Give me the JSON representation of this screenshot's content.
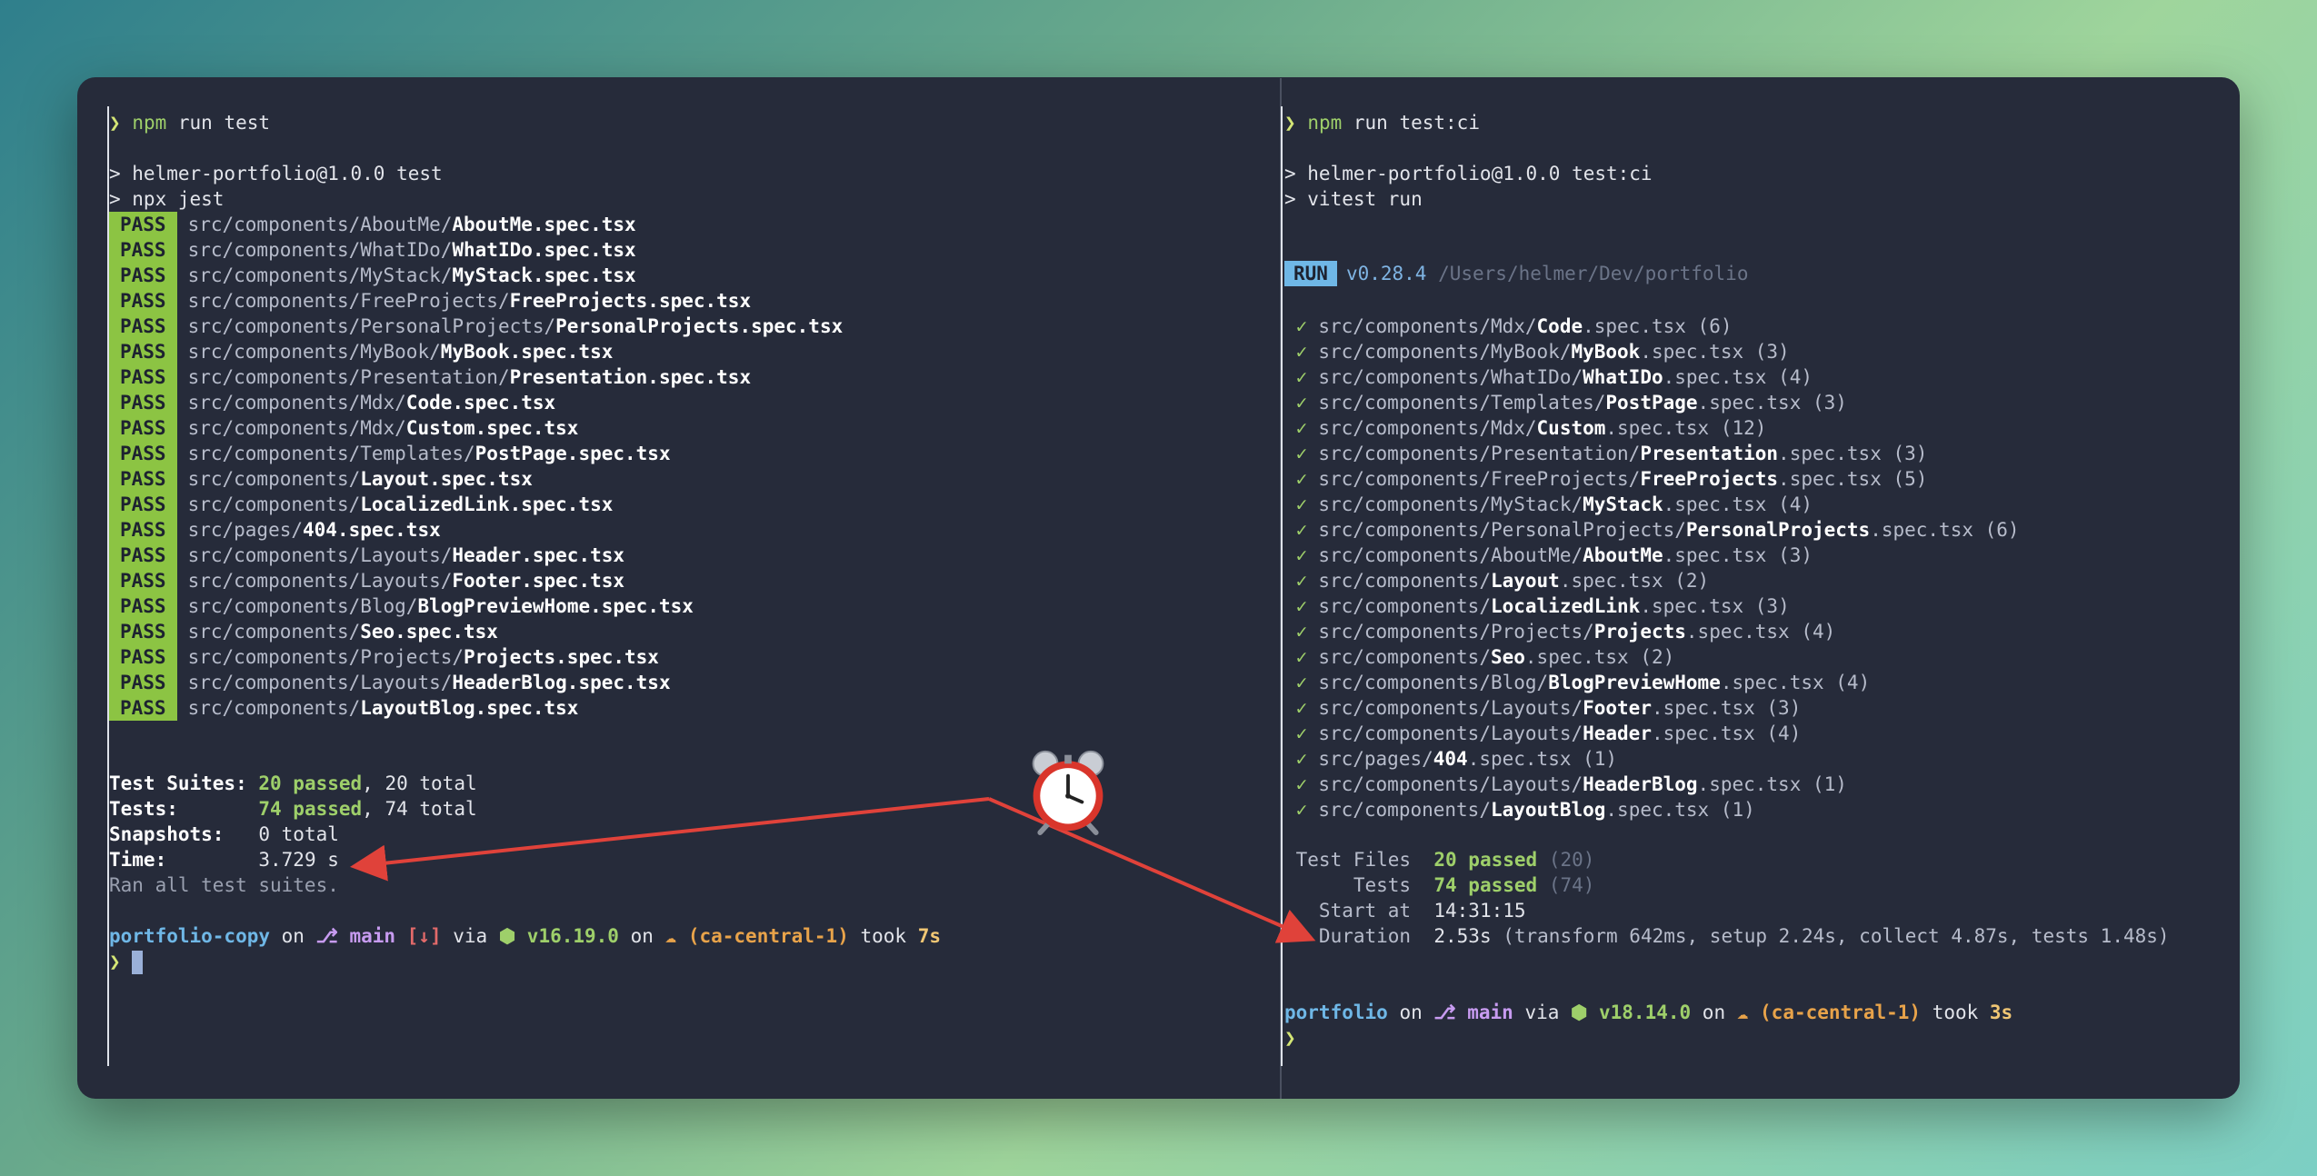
{
  "left": {
    "prompt_symbol": "❯",
    "command_bin": "npm",
    "command_args": " run test",
    "npm_header": "> helmer-portfolio@1.0.0 test",
    "npx_line": "> npx jest",
    "pass_label": "PASS",
    "results": [
      {
        "dir": "src/components/AboutMe/",
        "file": "AboutMe.spec.tsx"
      },
      {
        "dir": "src/components/WhatIDo/",
        "file": "WhatIDo.spec.tsx"
      },
      {
        "dir": "src/components/MyStack/",
        "file": "MyStack.spec.tsx"
      },
      {
        "dir": "src/components/FreeProjects/",
        "file": "FreeProjects.spec.tsx"
      },
      {
        "dir": "src/components/PersonalProjects/",
        "file": "PersonalProjects.spec.tsx"
      },
      {
        "dir": "src/components/MyBook/",
        "file": "MyBook.spec.tsx"
      },
      {
        "dir": "src/components/Presentation/",
        "file": "Presentation.spec.tsx"
      },
      {
        "dir": "src/components/Mdx/",
        "file": "Code.spec.tsx"
      },
      {
        "dir": "src/components/Mdx/",
        "file": "Custom.spec.tsx"
      },
      {
        "dir": "src/components/Templates/",
        "file": "PostPage.spec.tsx"
      },
      {
        "dir": "src/components/",
        "file": "Layout.spec.tsx"
      },
      {
        "dir": "src/components/",
        "file": "LocalizedLink.spec.tsx"
      },
      {
        "dir": "src/pages/",
        "file": "404.spec.tsx"
      },
      {
        "dir": "src/components/Layouts/",
        "file": "Header.spec.tsx"
      },
      {
        "dir": "src/components/Layouts/",
        "file": "Footer.spec.tsx"
      },
      {
        "dir": "src/components/Blog/",
        "file": "BlogPreviewHome.spec.tsx"
      },
      {
        "dir": "src/components/",
        "file": "Seo.spec.tsx"
      },
      {
        "dir": "src/components/Projects/",
        "file": "Projects.spec.tsx"
      },
      {
        "dir": "src/components/Layouts/",
        "file": "HeaderBlog.spec.tsx"
      },
      {
        "dir": "src/components/",
        "file": "LayoutBlog.spec.tsx"
      }
    ],
    "summary": {
      "suites_label": "Test Suites: ",
      "suites_passed": "20 passed",
      "suites_total": ", 20 total",
      "tests_label": "Tests:       ",
      "tests_passed": "74 passed",
      "tests_total": ", 74 total",
      "snapshots_label": "Snapshots:   ",
      "snapshots_value": "0 total",
      "time_label": "Time:        ",
      "time_value": "3.729 s",
      "ran_all": "Ran all test suites."
    },
    "status": {
      "dir": "portfolio-copy",
      "on": " on ",
      "branch_icon": "⎇",
      "branch": " main",
      "git_state": " [↓]",
      "via": " via ",
      "node_icon": "⬢",
      "node_version": " v16.19.0",
      "on2": " on ",
      "cloud_icon": "☁",
      "region": " (ca-central-1)",
      "took": " took ",
      "duration": "7s"
    }
  },
  "right": {
    "prompt_symbol": "❯",
    "command_bin": "npm",
    "command_args": " run test:ci",
    "npm_header": "> helmer-portfolio@1.0.0 test:ci",
    "vitest_line": "> vitest run",
    "run_label": "RUN",
    "version": "v0.28.4",
    "root": " /Users/helmer/Dev/portfolio",
    "check": "✓",
    "results": [
      {
        "dir": "src/components/Mdx/",
        "name": "Code",
        "ext": ".spec.tsx",
        "count": " (6)"
      },
      {
        "dir": "src/components/MyBook/",
        "name": "MyBook",
        "ext": ".spec.tsx",
        "count": " (3)"
      },
      {
        "dir": "src/components/WhatIDo/",
        "name": "WhatIDo",
        "ext": ".spec.tsx",
        "count": " (4)"
      },
      {
        "dir": "src/components/Templates/",
        "name": "PostPage",
        "ext": ".spec.tsx",
        "count": " (3)"
      },
      {
        "dir": "src/components/Mdx/",
        "name": "Custom",
        "ext": ".spec.tsx",
        "count": " (12)"
      },
      {
        "dir": "src/components/Presentation/",
        "name": "Presentation",
        "ext": ".spec.tsx",
        "count": " (3)"
      },
      {
        "dir": "src/components/FreeProjects/",
        "name": "FreeProjects",
        "ext": ".spec.tsx",
        "count": " (5)"
      },
      {
        "dir": "src/components/MyStack/",
        "name": "MyStack",
        "ext": ".spec.tsx",
        "count": " (4)"
      },
      {
        "dir": "src/components/PersonalProjects/",
        "name": "PersonalProjects",
        "ext": ".spec.tsx",
        "count": " (6)"
      },
      {
        "dir": "src/components/AboutMe/",
        "name": "AboutMe",
        "ext": ".spec.tsx",
        "count": " (3)"
      },
      {
        "dir": "src/components/",
        "name": "Layout",
        "ext": ".spec.tsx",
        "count": " (2)"
      },
      {
        "dir": "src/components/",
        "name": "LocalizedLink",
        "ext": ".spec.tsx",
        "count": " (3)"
      },
      {
        "dir": "src/components/Projects/",
        "name": "Projects",
        "ext": ".spec.tsx",
        "count": " (4)"
      },
      {
        "dir": "src/components/",
        "name": "Seo",
        "ext": ".spec.tsx",
        "count": " (2)"
      },
      {
        "dir": "src/components/Blog/",
        "name": "BlogPreviewHome",
        "ext": ".spec.tsx",
        "count": " (4)"
      },
      {
        "dir": "src/components/Layouts/",
        "name": "Footer",
        "ext": ".spec.tsx",
        "count": " (3)"
      },
      {
        "dir": "src/components/Layouts/",
        "name": "Header",
        "ext": ".spec.tsx",
        "count": " (4)"
      },
      {
        "dir": "src/pages/",
        "name": "404",
        "ext": ".spec.tsx",
        "count": " (1)"
      },
      {
        "dir": "src/components/Layouts/",
        "name": "HeaderBlog",
        "ext": ".spec.tsx",
        "count": " (1)"
      },
      {
        "dir": "src/components/",
        "name": "LayoutBlog",
        "ext": ".spec.tsx",
        "count": " (1)"
      }
    ],
    "summary": {
      "files_label": " Test Files  ",
      "files_passed": "20 passed",
      "files_count": " (20)",
      "tests_label": "      Tests  ",
      "tests_passed": "74 passed",
      "tests_count": " (74)",
      "start_label": "   Start at  ",
      "start_value": "14:31:15",
      "duration_label": "   Duration  ",
      "duration_value": "2.53s",
      "duration_detail": " (transform 642ms, setup 2.24s, collect 4.87s, tests 1.48s)"
    },
    "status": {
      "dir": "portfolio",
      "on": " on ",
      "branch_icon": "⎇",
      "branch": " main",
      "via": " via ",
      "node_icon": "⬢",
      "node_version": " v18.14.0",
      "on2": " on ",
      "cloud_icon": "☁",
      "region": " (ca-central-1)",
      "took": " took ",
      "duration": "3s"
    }
  },
  "colors": {
    "pass_bg": "#8cc443",
    "run_bg": "#6fb7e6",
    "arrow": "#e0423a",
    "window_bg": "#262b3a"
  },
  "icons": [
    "alarm-clock-icon",
    "branch-icon",
    "node-icon",
    "cloud-icon",
    "prompt-chevron-icon",
    "check-icon"
  ]
}
